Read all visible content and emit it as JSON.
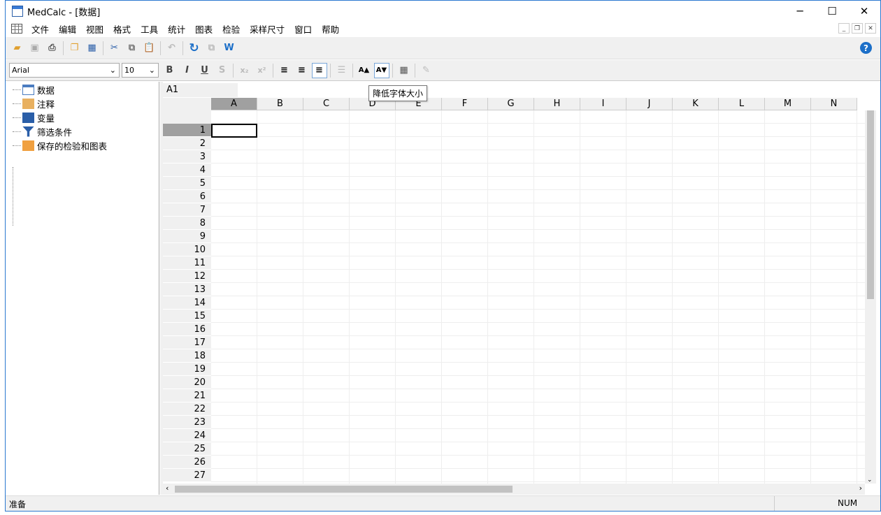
{
  "window": {
    "title": "MedCalc - [数据]"
  },
  "menu": [
    "文件",
    "编辑",
    "视图",
    "格式",
    "工具",
    "统计",
    "图表",
    "检验",
    "采样尺寸",
    "窗口",
    "帮助"
  ],
  "format_bar": {
    "font": "Arial",
    "size": "10",
    "bold": "B",
    "italic": "I",
    "underline": "U",
    "strike": "S",
    "subscript": "x₂",
    "superscript": "x²",
    "increase_font": "A▲",
    "decrease_font": "A▼"
  },
  "tooltip": "降低字体大小",
  "tree": [
    "数据",
    "注释",
    "变量",
    "筛选条件",
    "保存的检验和图表"
  ],
  "grid": {
    "namebox": "A1",
    "columns": [
      "A",
      "B",
      "C",
      "D",
      "E",
      "F",
      "G",
      "H",
      "I",
      "J",
      "K",
      "L",
      "M",
      "N"
    ],
    "rows": [
      "1",
      "2",
      "3",
      "4",
      "5",
      "6",
      "7",
      "8",
      "9",
      "10",
      "11",
      "12",
      "13",
      "14",
      "15",
      "16",
      "17",
      "18",
      "19",
      "20",
      "21",
      "22",
      "23",
      "24",
      "25",
      "26",
      "27"
    ]
  },
  "status": {
    "text": "准备",
    "num": "NUM"
  },
  "colors": {
    "accent": "#2b79d0",
    "selected_header": "#a0a0a0"
  }
}
